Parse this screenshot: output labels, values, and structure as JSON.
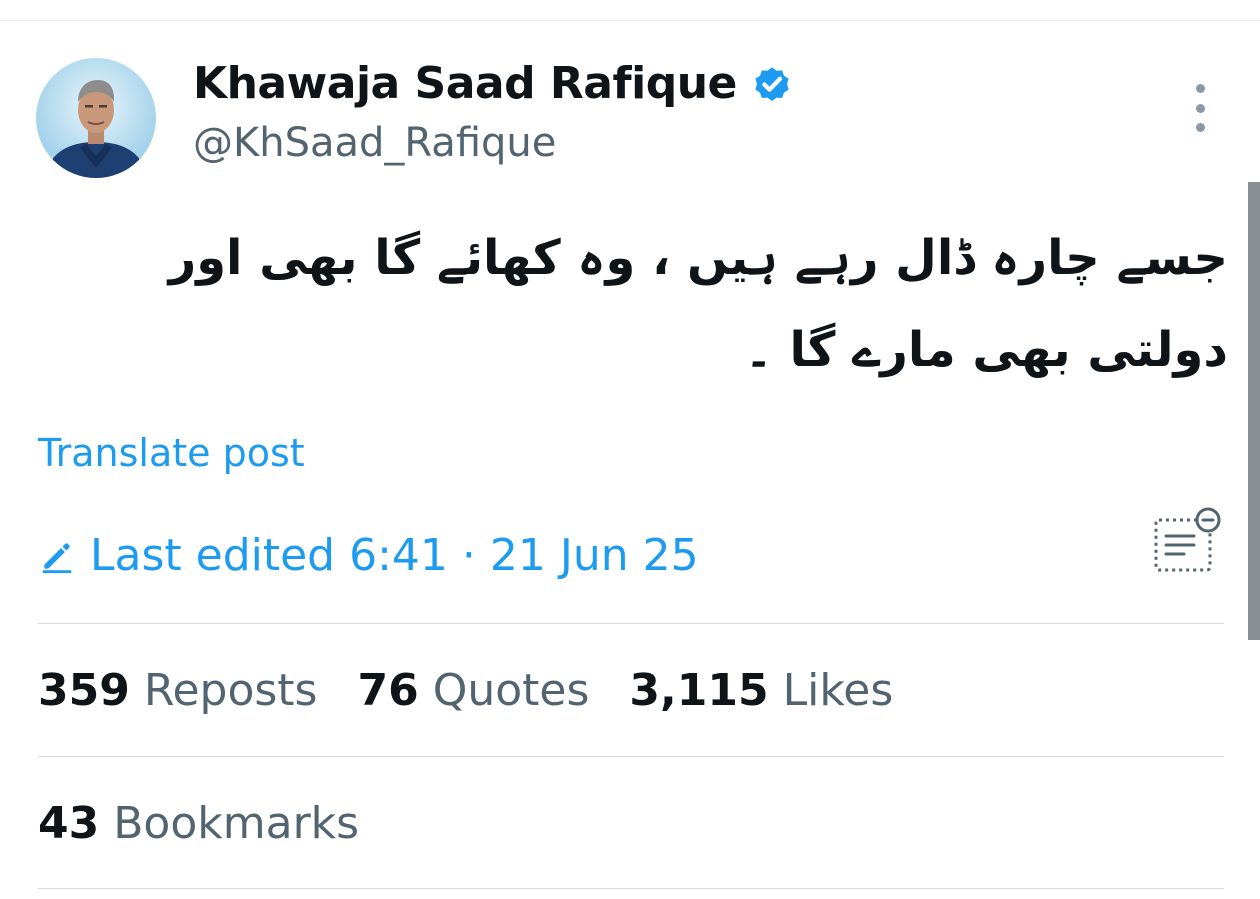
{
  "author": {
    "display_name": "Khawaja Saad Rafique",
    "handle": "@KhSaad_Rafique",
    "verified": true
  },
  "post": {
    "text": "جسے چارہ  ڈال رہے ہیں ، وہ کھائے گا بھی اور دولتی بھی مارے گا ۔"
  },
  "translate_label": "Translate post",
  "edit_info": {
    "label": "Last edited 6:41 · 21 Jun 25"
  },
  "stats": {
    "reposts": {
      "count": "359",
      "label": "Reposts"
    },
    "quotes": {
      "count": "76",
      "label": "Quotes"
    },
    "likes": {
      "count": "3,115",
      "label": "Likes"
    },
    "bookmarks": {
      "count": "43",
      "label": "Bookmarks"
    }
  },
  "colors": {
    "accent": "#1d9bf0",
    "text": "#0f1419",
    "secondary": "#536471",
    "divider": "#d9dde1"
  },
  "icons": [
    "verified-badge-icon",
    "more-options-icon",
    "pencil-icon",
    "edit-history-icon"
  ]
}
